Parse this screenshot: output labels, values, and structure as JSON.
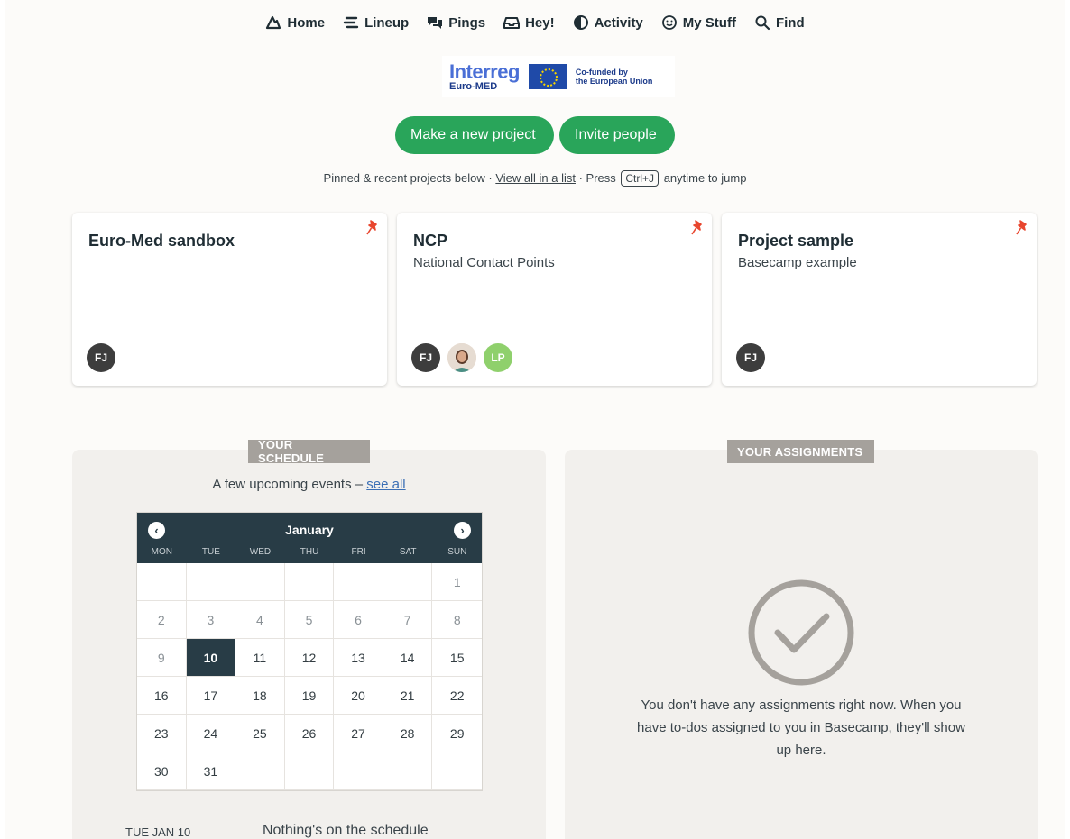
{
  "nav": {
    "home": "Home",
    "lineup": "Lineup",
    "pings": "Pings",
    "hey": "Hey!",
    "activity": "Activity",
    "my_stuff": "My Stuff",
    "find": "Find"
  },
  "logo": {
    "name": "Interreg",
    "region": "Euro-MED",
    "cofund_line1": "Co-funded by",
    "cofund_line2": "the European Union"
  },
  "actions": {
    "new_project": "Make a new project",
    "invite": "Invite people"
  },
  "hint": {
    "prefix": "Pinned & recent projects below ·",
    "link": "View all in a list",
    "middle": "· Press",
    "key": "Ctrl+J",
    "suffix": "anytime to jump"
  },
  "projects": [
    {
      "title": "Euro-Med sandbox",
      "description": "",
      "avatars": [
        "FJ"
      ]
    },
    {
      "title": "NCP",
      "description": "National Contact Points",
      "avatars": [
        "FJ",
        "",
        "LP"
      ]
    },
    {
      "title": "Project sample",
      "description": "Basecamp example",
      "avatars": [
        "FJ"
      ]
    }
  ],
  "schedule": {
    "tag": "YOUR SCHEDULE",
    "subtitle": "A few upcoming events –",
    "see_all": "see all",
    "month": "January",
    "dows": [
      "MON",
      "TUE",
      "WED",
      "THU",
      "FRI",
      "SAT",
      "SUN"
    ],
    "days": [
      "",
      "",
      "",
      "",
      "",
      "",
      "1",
      "2",
      "3",
      "4",
      "5",
      "6",
      "7",
      "8",
      "9",
      "10",
      "11",
      "12",
      "13",
      "14",
      "15",
      "16",
      "17",
      "18",
      "19",
      "20",
      "21",
      "22",
      "23",
      "24",
      "25",
      "26",
      "27",
      "28",
      "29",
      "30",
      "31",
      "",
      "",
      "",
      "",
      ""
    ],
    "today": "10",
    "footer_date": "TUE JAN 10",
    "footer_message": "Nothing's on the schedule"
  },
  "assignments": {
    "tag": "YOUR ASSIGNMENTS",
    "empty_message": "You don't have any assignments right now. When you have to-dos assigned to you in Basecamp, they'll show up here."
  },
  "colors": {
    "accent_green": "#29a55a",
    "navy": "#283c46",
    "pin_red": "#e8462e",
    "lp_avatar": "#8fd06c"
  }
}
